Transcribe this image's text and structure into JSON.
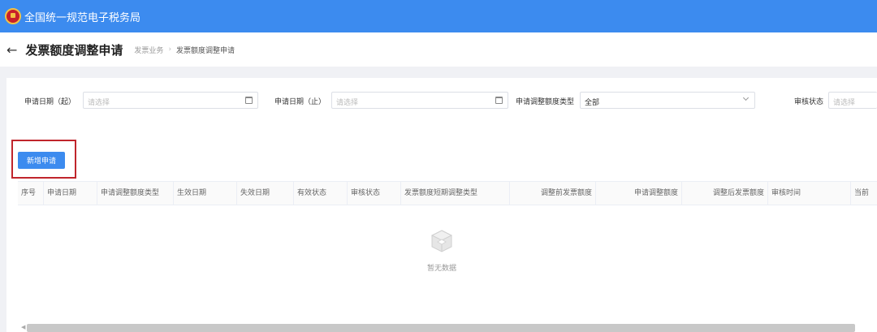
{
  "app": {
    "title": "全国统一规范电子税务局"
  },
  "header": {
    "title": "发票额度调整申请",
    "breadcrumb": [
      "发票业务",
      "发票额度调整申请"
    ]
  },
  "filters": {
    "start_date": {
      "label": "申请日期（起）",
      "placeholder": "请选择"
    },
    "end_date": {
      "label": "申请日期（止）",
      "placeholder": "请选择"
    },
    "adjust_type": {
      "label": "申请调整额度类型",
      "value": "全部"
    },
    "audit_status": {
      "label": "审核状态",
      "placeholder": "请选择"
    }
  },
  "actions": {
    "add_label": "新增申请"
  },
  "table": {
    "columns": [
      "序号",
      "申请日期",
      "申请调整额度类型",
      "生效日期",
      "失效日期",
      "有效状态",
      "审核状态",
      "发票额度短期调整类型",
      "调整前发票额度",
      "申请调整额度",
      "调整后发票额度",
      "审核时间",
      "当前"
    ],
    "empty_text": "暂无数据"
  },
  "colors": {
    "primary": "#3c8bef",
    "highlight": "#c0252c"
  }
}
